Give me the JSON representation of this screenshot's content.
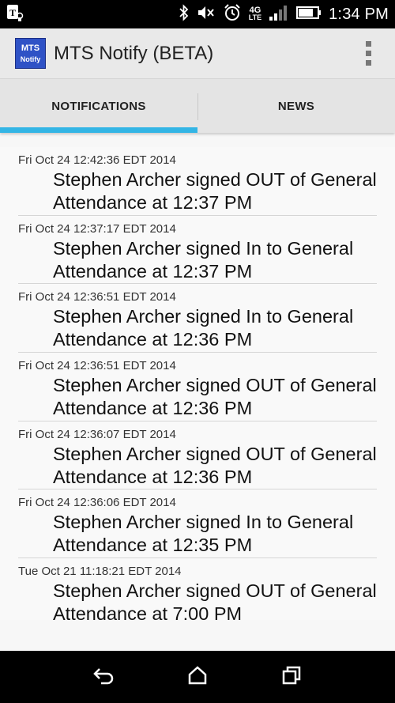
{
  "status_bar": {
    "network_label": "4G",
    "network_sub": "LTE",
    "battery_level": 0.8,
    "clock": "1:34 PM"
  },
  "app_bar": {
    "logo_line1": "MTS",
    "logo_line2": "Notify",
    "title": "MTS Notify (BETA)"
  },
  "tabs": [
    {
      "label": "NOTIFICATIONS",
      "selected": true
    },
    {
      "label": "NEWS",
      "selected": false
    }
  ],
  "notifications": [
    {
      "timestamp": "Fri Oct 24 12:42:36 EDT 2014",
      "message": "Stephen Archer signed OUT of General Attendance at 12:37 PM"
    },
    {
      "timestamp": "Fri Oct 24 12:37:17 EDT 2014",
      "message": "Stephen Archer signed In to General Attendance at 12:37 PM"
    },
    {
      "timestamp": "Fri Oct 24 12:36:51 EDT 2014",
      "message": "Stephen Archer signed In to General Attendance at 12:36 PM"
    },
    {
      "timestamp": "Fri Oct 24 12:36:51 EDT 2014",
      "message": "Stephen Archer signed OUT of General Attendance at 12:36 PM"
    },
    {
      "timestamp": "Fri Oct 24 12:36:07 EDT 2014",
      "message": "Stephen Archer signed OUT of General Attendance at 12:36 PM"
    },
    {
      "timestamp": "Fri Oct 24 12:36:06 EDT 2014",
      "message": "Stephen Archer signed In to General Attendance at 12:35 PM"
    },
    {
      "timestamp": "Tue Oct 21 11:18:21 EDT 2014",
      "message": "Stephen Archer signed OUT of General Attendance at 7:00 PM"
    }
  ],
  "colors": {
    "tab_indicator": "#33b5e5",
    "logo_background": "#2f52c6"
  }
}
